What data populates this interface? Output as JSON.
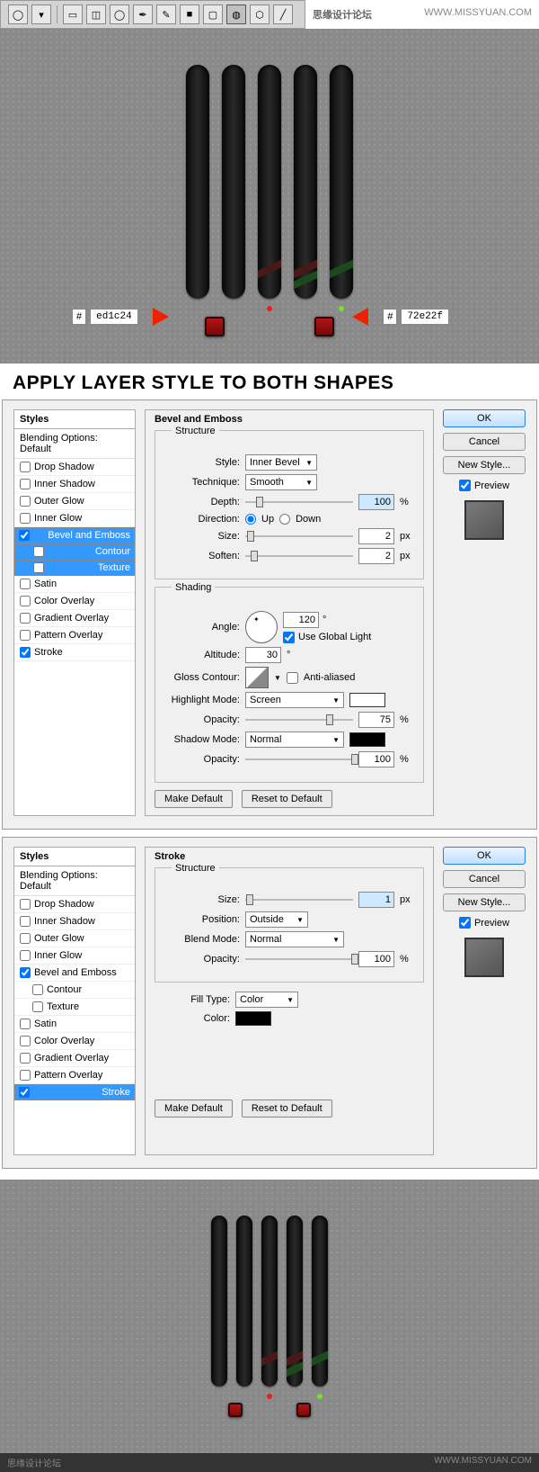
{
  "watermark": {
    "brand": "思缘设计论坛",
    "url": "WWW.MISSYUAN.COM"
  },
  "colors": {
    "hash": "#",
    "red": "ed1c24",
    "green": "72e22f"
  },
  "heading": "APPLY LAYER STYLE TO BOTH SHAPES",
  "sidebar": {
    "title": "Styles",
    "blending": "Blending Options: Default",
    "items": [
      "Drop Shadow",
      "Inner Shadow",
      "Outer Glow",
      "Inner Glow",
      "Bevel and Emboss",
      "Contour",
      "Texture",
      "Satin",
      "Color Overlay",
      "Gradient Overlay",
      "Pattern Overlay",
      "Stroke"
    ]
  },
  "bevel": {
    "title": "Bevel and Emboss",
    "structure": "Structure",
    "style_lbl": "Style:",
    "style_val": "Inner Bevel",
    "technique_lbl": "Technique:",
    "technique_val": "Smooth",
    "depth_lbl": "Depth:",
    "depth_val": "100",
    "pct": "%",
    "direction_lbl": "Direction:",
    "up": "Up",
    "down": "Down",
    "size_lbl": "Size:",
    "size_val": "2",
    "px": "px",
    "soften_lbl": "Soften:",
    "soften_val": "2",
    "shading": "Shading",
    "angle_lbl": "Angle:",
    "angle_val": "120",
    "deg": "°",
    "global": "Use Global Light",
    "altitude_lbl": "Altitude:",
    "altitude_val": "30",
    "gloss_lbl": "Gloss Contour:",
    "anti": "Anti-aliased",
    "highlight_lbl": "Highlight Mode:",
    "highlight_val": "Screen",
    "opacity_lbl": "Opacity:",
    "h_opacity": "75",
    "shadow_lbl": "Shadow Mode:",
    "shadow_val": "Normal",
    "s_opacity": "100",
    "make_default": "Make Default",
    "reset": "Reset to Default"
  },
  "stroke": {
    "title": "Stroke",
    "structure": "Structure",
    "size_lbl": "Size:",
    "size_val": "1",
    "px": "px",
    "position_lbl": "Position:",
    "position_val": "Outside",
    "blend_lbl": "Blend Mode:",
    "blend_val": "Normal",
    "opacity_lbl": "Opacity:",
    "opacity_val": "100",
    "pct": "%",
    "fill_lbl": "Fill Type:",
    "fill_val": "Color",
    "color_lbl": "Color:",
    "make_default": "Make Default",
    "reset": "Reset to Default"
  },
  "buttons": {
    "ok": "OK",
    "cancel": "Cancel",
    "new_style": "New Style...",
    "preview": "Preview"
  }
}
